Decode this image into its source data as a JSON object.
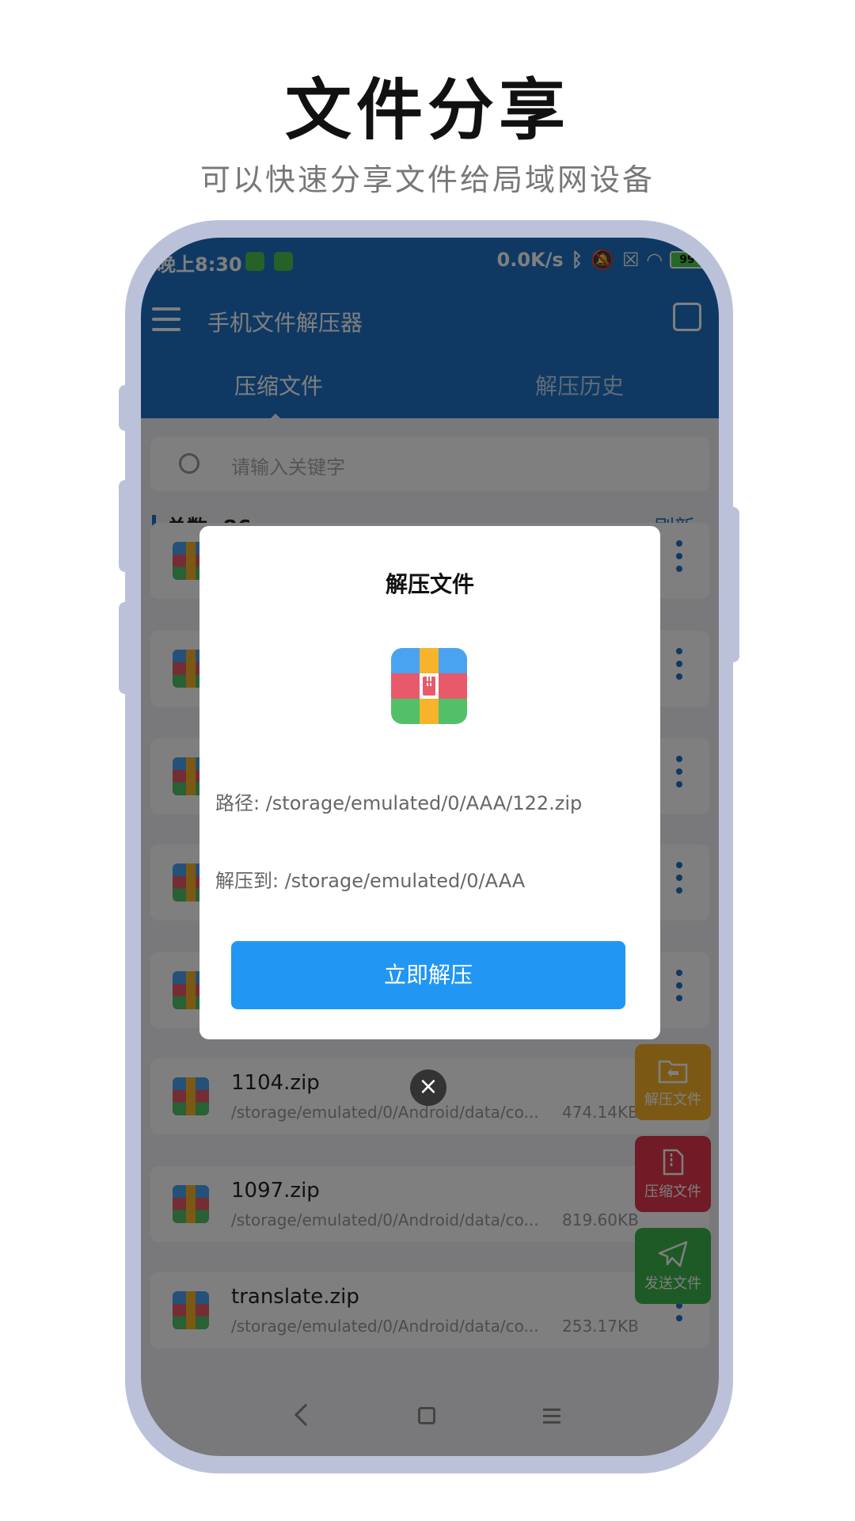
{
  "promo": {
    "title": "文件分享",
    "subtitle": "可以快速分享文件给局域网设备"
  },
  "status_bar": {
    "time": "晚上8:30",
    "net_speed": "0.0K/s",
    "battery": "99"
  },
  "app_bar": {
    "title": "手机文件解压器"
  },
  "tabs": [
    {
      "label": "压缩文件",
      "active": true
    },
    {
      "label": "解压历史",
      "active": false
    }
  ],
  "search": {
    "placeholder": "请输入关键字"
  },
  "list_header": {
    "count_label": "总数: 86",
    "refresh_label": "刷新"
  },
  "files": [
    {
      "name": "",
      "path": "",
      "size": ""
    },
    {
      "name": "",
      "path": "",
      "size": ""
    },
    {
      "name": "",
      "path": "",
      "size": ""
    },
    {
      "name": "",
      "path": "",
      "size": ""
    },
    {
      "name": "",
      "path": "",
      "size": ""
    },
    {
      "name": "1104.zip",
      "path": "/storage/emulated/0/Android/data/co...",
      "size": "474.14KB"
    },
    {
      "name": "1097.zip",
      "path": "/storage/emulated/0/Android/data/co...",
      "size": "819.60KB"
    },
    {
      "name": "translate.zip",
      "path": "/storage/emulated/0/Android/data/co...",
      "size": "253.17KB"
    }
  ],
  "fabs": {
    "extract": "解压文件",
    "compress": "压缩文件",
    "send": "发送文件"
  },
  "dialog": {
    "title": "解压文件",
    "path": "路径: /storage/emulated/0/AAA/122.zip",
    "destination": "解压到: /storage/emulated/0/AAA",
    "button": "立即解压"
  },
  "colors": {
    "primary": "#1e73c7",
    "button": "#2196f3",
    "fab_extract": "#f7b32b",
    "fab_compress": "#e0364a",
    "fab_send": "#3cb54a"
  }
}
